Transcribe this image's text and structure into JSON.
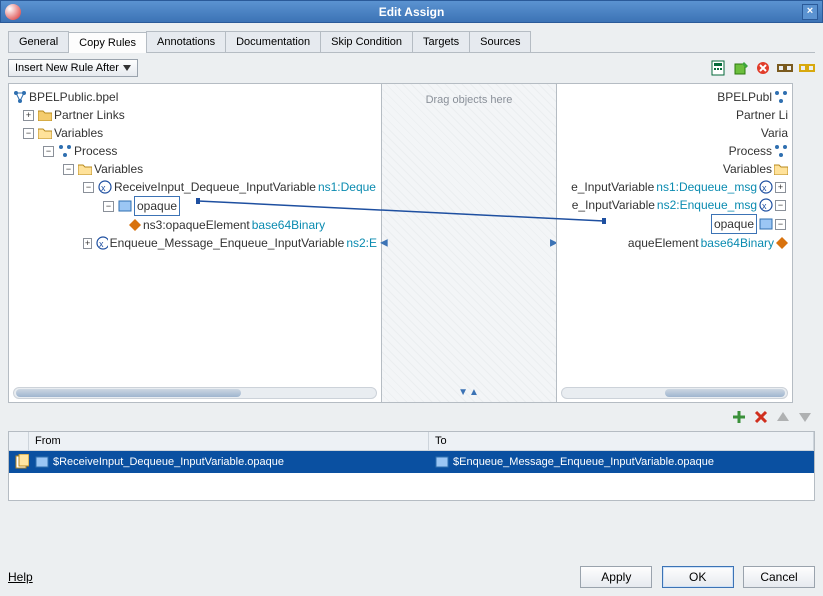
{
  "title": "Edit Assign",
  "tabs": [
    "General",
    "Copy Rules",
    "Annotations",
    "Documentation",
    "Skip Condition",
    "Targets",
    "Sources"
  ],
  "activeTab": 1,
  "insertRuleLabel": "Insert New Rule After",
  "midText": "Drag objects here",
  "leftTree": {
    "root": "BPELPublic.bpel",
    "partnerLinks": "Partner Links",
    "variables": "Variables",
    "process": "Process",
    "variables2": "Variables",
    "receiveVar": "ReceiveInput_Dequeue_InputVariable",
    "receiveType": "ns1:Deque",
    "opaque": "opaque",
    "opaqueElem": "ns3:opaqueElement",
    "opaqueElemType": "base64Binary",
    "enqueueVar": "Enqueue_Message_Enqueue_InputVariable",
    "enqueueType": "ns2:E"
  },
  "rightTree": {
    "root": "BPELPubl",
    "partnerLinks": "Partner Li",
    "variables": "Varia",
    "process": "Process",
    "variables2": "Variables",
    "inVar": "e_InputVariable",
    "inType": "ns1:Dequeue_msg",
    "outVar": "e_InputVariable",
    "outType": "ns2:Enqueue_msg",
    "opaque": "opaque",
    "opaqueElem": "aqueElement",
    "opaqueElemType": "base64Binary"
  },
  "grid": {
    "fromHeader": "From",
    "toHeader": "To",
    "fromValue": "$ReceiveInput_Dequeue_InputVariable.opaque",
    "toValue": "$Enqueue_Message_Enqueue_InputVariable.opaque"
  },
  "footer": {
    "help": "Help",
    "apply": "Apply",
    "ok": "OK",
    "cancel": "Cancel"
  }
}
